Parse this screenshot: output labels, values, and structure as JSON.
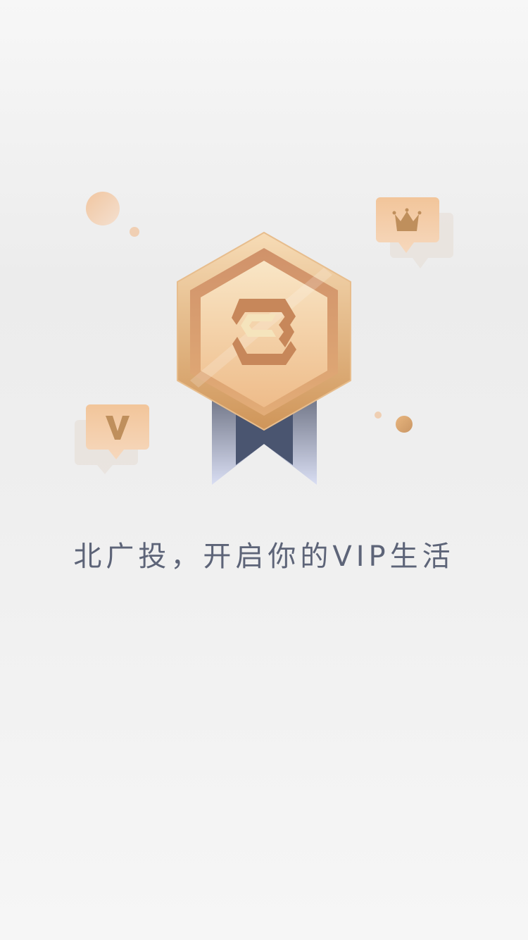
{
  "splash": {
    "slogan": "北广投，开启你的VIP生活",
    "badge_letter": "V",
    "icons": [
      "medal-logo-icon",
      "crown-icon",
      "vip-v-icon"
    ],
    "colors": {
      "gold": "#e9b98a",
      "ribbon": "#4a5570",
      "text": "#5d6478"
    }
  }
}
